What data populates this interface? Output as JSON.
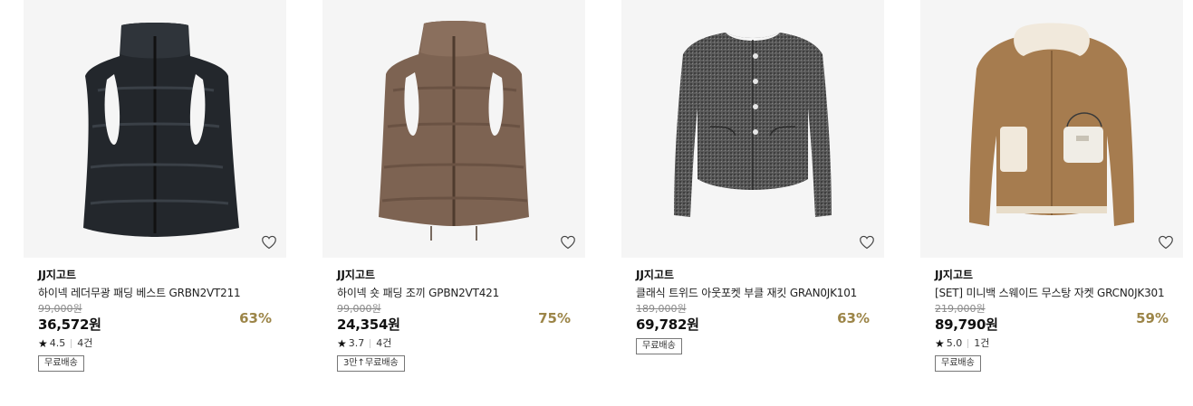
{
  "products": [
    {
      "brand": "JJ지고트",
      "title": "하이넥 레더무광 패딩 베스트 GRBN2VT211",
      "original_price": "99,000원",
      "price": "36,572원",
      "discount": "63%",
      "rating_star": "★",
      "rating": "4.5",
      "review_count": "4건",
      "badge": "무료배송",
      "image_icon": "black-padded-vest-image"
    },
    {
      "brand": "JJ지고트",
      "title": "하이넥 숏 패딩 조끼 GPBN2VT421",
      "original_price": "99,000원",
      "price": "24,354원",
      "discount": "75%",
      "rating_star": "★",
      "rating": "3.7",
      "review_count": "4건",
      "badge": "3만↑무료배송",
      "image_icon": "brown-padded-vest-image"
    },
    {
      "brand": "JJ지고트",
      "title": "클래식 트위드 아웃포켓 부클 재킷 GRAN0JK101",
      "original_price": "189,000원",
      "price": "69,782원",
      "discount": "63%",
      "badge": "무료배송",
      "image_icon": "grey-tweed-jacket-image"
    },
    {
      "brand": "JJ지고트",
      "title": "[SET] 미니백 스웨이드 무스탕 자켓 GRCN0JK301",
      "original_price": "219,000원",
      "price": "89,790원",
      "discount": "59%",
      "rating_star": "★",
      "rating": "5.0",
      "review_count": "1건",
      "badge": "무료배송",
      "image_icon": "suede-mustang-jacket-image"
    }
  ],
  "colors": {
    "discount": "#9c8548",
    "image_bg": "#f5f5f5",
    "vest_black": "#23272c",
    "vest_brown": "#7d6352",
    "tweed_grey": "#5a5a5a",
    "suede_tan": "#a67c4f"
  },
  "icons": {
    "wishlist": "heart-outline-icon",
    "rating": "star-icon"
  }
}
